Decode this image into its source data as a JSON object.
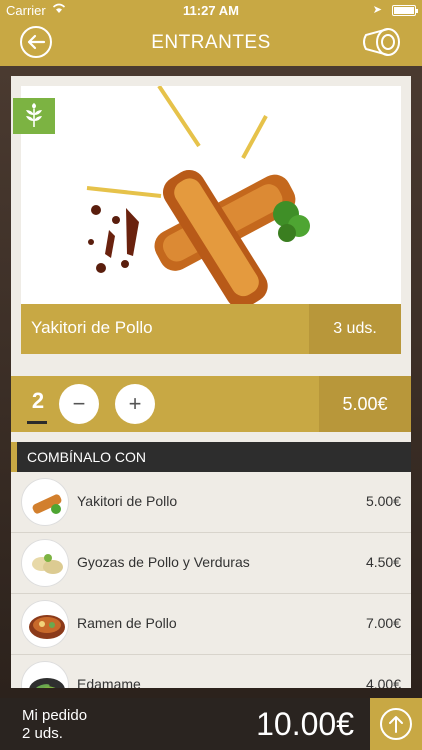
{
  "status_bar": {
    "carrier": "Carrier",
    "time": "11:27 AM"
  },
  "nav": {
    "title": "ENTRANTES"
  },
  "product": {
    "name": "Yakitori de Pollo",
    "units": "3 uds."
  },
  "order_control": {
    "quantity": "2",
    "price": "5.00€"
  },
  "combo": {
    "header": "COMBÍNALO CON",
    "items": [
      {
        "name": "Yakitori de Pollo",
        "price": "5.00€"
      },
      {
        "name": "Gyozas de Pollo y Verduras",
        "price": "4.50€"
      },
      {
        "name": "Ramen de Pollo",
        "price": "7.00€"
      },
      {
        "name": "Edamame",
        "price": "4.00€"
      }
    ]
  },
  "footer": {
    "label": "Mi pedido",
    "count": "2 uds.",
    "total": "10.00€"
  },
  "colors": {
    "accent": "#c8a844",
    "accent_dark": "#b8973a",
    "badge_green": "#7cb342",
    "dark": "#2d2d2d"
  }
}
